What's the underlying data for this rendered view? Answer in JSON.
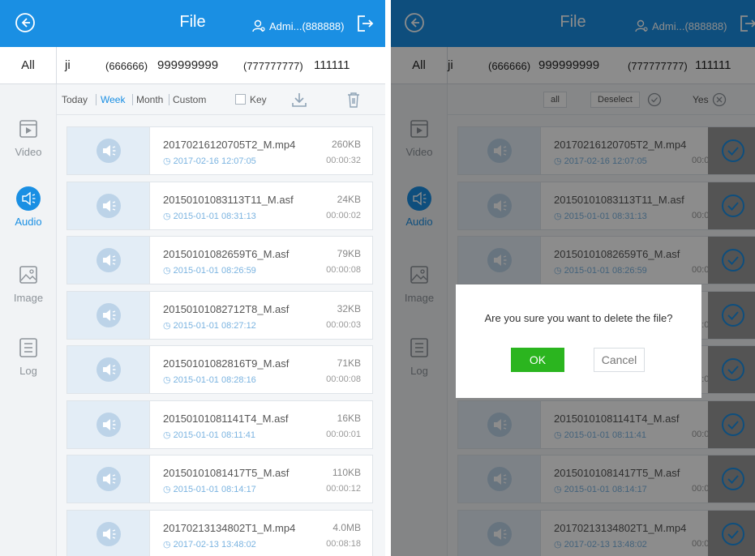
{
  "colors": {
    "brand": "#1a8fe3",
    "ok": "#2bb51f",
    "time_text": "#7ab3e0"
  },
  "header": {
    "title": "File",
    "user": "Admi...(888888)"
  },
  "devices": {
    "all": "All",
    "items": [
      {
        "label": "ji"
      },
      {
        "label": "(666666)"
      },
      {
        "label": "999999999"
      },
      {
        "label": "(777777777)"
      },
      {
        "label": "111111"
      }
    ]
  },
  "sidebar": {
    "items": [
      {
        "label": "Video",
        "icon": "video-icon"
      },
      {
        "label": "Audio",
        "icon": "audio-icon",
        "active": true
      },
      {
        "label": "Image",
        "icon": "image-icon"
      },
      {
        "label": "Log",
        "icon": "log-icon"
      }
    ]
  },
  "filter": {
    "today": "Today",
    "week": "Week",
    "month": "Month",
    "custom": "Custom",
    "key": "Key",
    "active": "Week"
  },
  "selection": {
    "all": "all",
    "deselect": "Deselect",
    "yes": "Yes"
  },
  "files": [
    {
      "name": "20170216120705T2_M.mp4",
      "time": "2017-02-16 12:07:05",
      "size": "260KB",
      "duration": "00:00:32"
    },
    {
      "name": "20150101083113T11_M.asf",
      "time": "2015-01-01 08:31:13",
      "size": "24KB",
      "duration": "00:00:02"
    },
    {
      "name": "20150101082659T6_M.asf",
      "time": "2015-01-01 08:26:59",
      "size": "79KB",
      "duration": "00:00:08"
    },
    {
      "name": "20150101082712T8_M.asf",
      "time": "2015-01-01 08:27:12",
      "size": "32KB",
      "duration": "00:00:03"
    },
    {
      "name": "20150101082816T9_M.asf",
      "time": "2015-01-01 08:28:16",
      "size": "71KB",
      "duration": "00:00:08"
    },
    {
      "name": "20150101081141T4_M.asf",
      "time": "2015-01-01 08:11:41",
      "size": "16KB",
      "duration": "00:00:01"
    },
    {
      "name": "20150101081417T5_M.asf",
      "time": "2015-01-01 08:14:17",
      "size": "110KB",
      "duration": "00:00:12"
    },
    {
      "name": "20170213134802T1_M.mp4",
      "time": "2017-02-13 13:48:02",
      "size": "4.0MB",
      "duration": "00:08:18"
    }
  ],
  "dialog": {
    "message": "Are you sure you want to delete the file?",
    "ok": "OK",
    "cancel": "Cancel"
  }
}
